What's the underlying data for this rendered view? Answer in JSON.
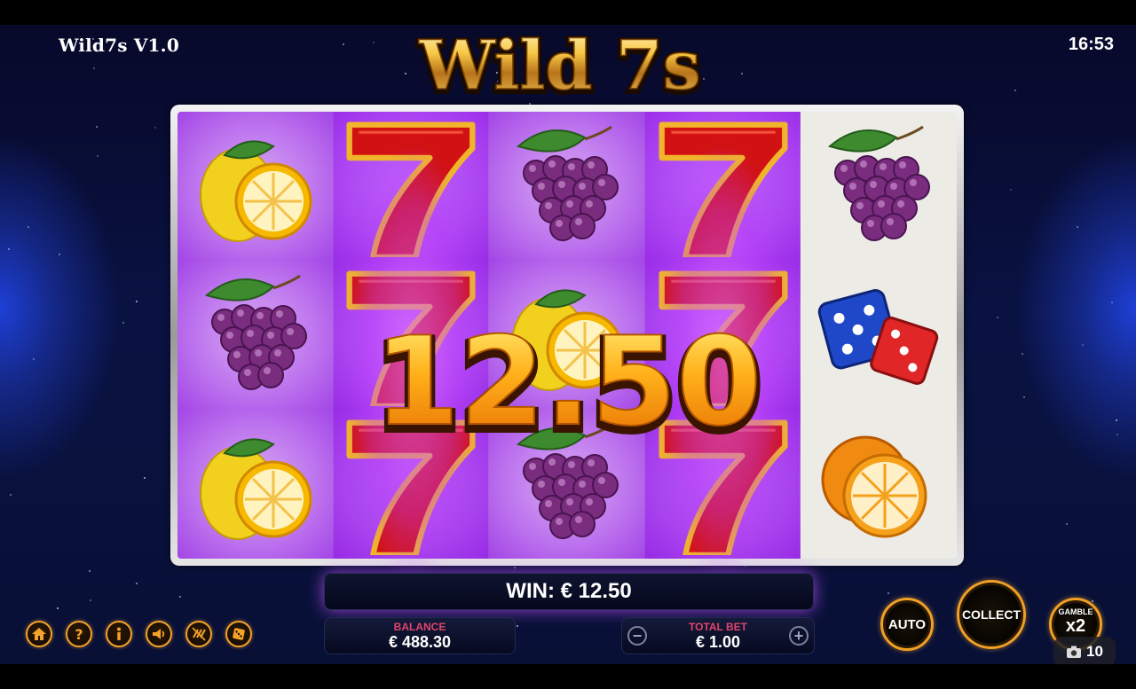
{
  "window": {
    "title": "Wild7s V1.0",
    "clock": "16:53"
  },
  "logo": {
    "text": "Wild 7s"
  },
  "reels": {
    "columns": [
      [
        "lemon",
        "grapes",
        "lemon"
      ],
      [
        "seven",
        "seven",
        "seven"
      ],
      [
        "grapes",
        "lemon",
        "grapes"
      ],
      [
        "seven",
        "seven",
        "seven"
      ],
      [
        "grapes",
        "dice",
        "orange"
      ]
    ],
    "winning_reels": [
      1,
      3
    ]
  },
  "big_win": {
    "amount": "12.50"
  },
  "win_bar": {
    "text": "WIN: € 12.50"
  },
  "balance": {
    "label": "BALANCE",
    "value": "€ 488.30"
  },
  "total_bet": {
    "label": "TOTAL BET",
    "value": "€ 1.00",
    "minus": "−",
    "plus": "+"
  },
  "toolbar": {
    "icons": [
      "home-icon",
      "help-icon",
      "info-icon",
      "sound-icon",
      "turbo-icon",
      "dice-icon"
    ]
  },
  "controls": {
    "auto_label": "AUTO",
    "collect_label": "COLLECT",
    "gamble_label": "GAMBLE",
    "gamble_multiplier": "x2"
  },
  "counter": {
    "value": "10"
  },
  "colors": {
    "accent_orange": "#f0a024",
    "win_purple": "#b04cff",
    "balance_label": "#e0456c",
    "background": "#0a1242"
  }
}
